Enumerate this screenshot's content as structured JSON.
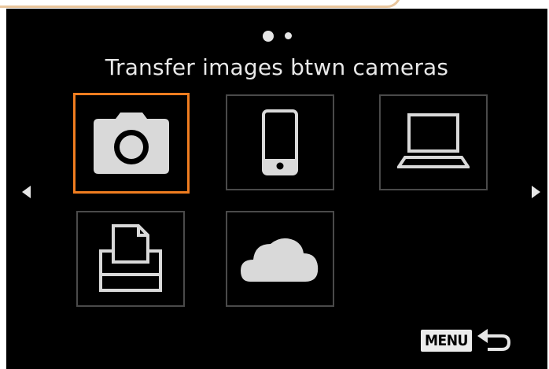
{
  "header": {
    "title": "Transfer images btwn cameras",
    "pages": {
      "current": 1,
      "total": 2
    }
  },
  "devices": [
    {
      "name": "Camera",
      "icon": "camera-icon",
      "selected": true
    },
    {
      "name": "Smartphone",
      "icon": "smartphone-icon",
      "selected": false
    },
    {
      "name": "Computer",
      "icon": "laptop-icon",
      "selected": false
    },
    {
      "name": "Printer",
      "icon": "printer-icon",
      "selected": false
    },
    {
      "name": "Web Service",
      "icon": "cloud-icon",
      "selected": false
    }
  ],
  "footer": {
    "menu_label": "MENU",
    "back_icon": "return-arrow-icon"
  },
  "colors": {
    "background": "#000000",
    "selection": "#ef7d20",
    "icon": "#d9d9d9",
    "tile_border": "#4a4a4a",
    "frame": "#e9c69d"
  }
}
